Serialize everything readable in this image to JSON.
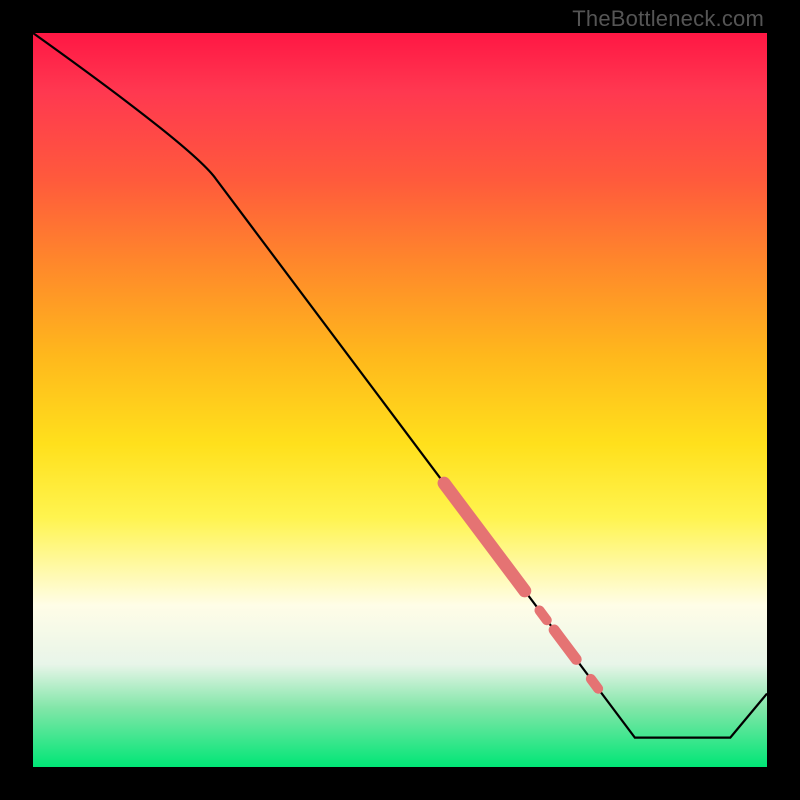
{
  "attribution": "TheBottleneck.com",
  "chart_data": {
    "type": "line",
    "title": "",
    "xlabel": "",
    "ylabel": "",
    "xlim": [
      0,
      100
    ],
    "ylim": [
      0,
      100
    ],
    "background": "rainbow-gradient red-top to green-bottom",
    "curve": [
      {
        "x": 0,
        "y": 100
      },
      {
        "x": 25,
        "y": 80
      },
      {
        "x": 82,
        "y": 4
      },
      {
        "x": 95,
        "y": 4
      },
      {
        "x": 100,
        "y": 10
      }
    ],
    "highlight_segments": [
      {
        "x_start": 56,
        "x_end": 67,
        "thickness": "thick"
      },
      {
        "x_start": 69,
        "x_end": 70,
        "thickness": "dot"
      },
      {
        "x_start": 71,
        "x_end": 74,
        "thickness": "medium"
      },
      {
        "x_start": 76,
        "x_end": 77,
        "thickness": "dot"
      }
    ],
    "highlight_color": "#e57373"
  }
}
